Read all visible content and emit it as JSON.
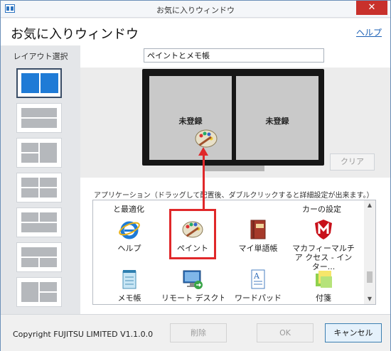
{
  "window": {
    "title": "お気に入りウィンドウ",
    "close_glyph": "✕"
  },
  "header": {
    "app_title": "お気に入りウィンドウ",
    "help_link": "ヘルプ"
  },
  "layout_panel": {
    "title": "レイアウト選択",
    "selected_index": 0
  },
  "preview": {
    "layout_name": "ペイントとメモ帳",
    "slots": [
      {
        "label": "未登録"
      },
      {
        "label": "未登録"
      }
    ],
    "clear_button": "クリア"
  },
  "apps": {
    "caption": "アプリケーション（ドラッグして配置後、ダブルクリックすると詳細設定が出来ます。）",
    "partial_top_labels": [
      "と最適化",
      "カーの設定"
    ],
    "items": [
      {
        "label": "ヘルプ",
        "icon": "ie-icon"
      },
      {
        "label": "ペイント",
        "icon": "paint-icon",
        "highlighted": true
      },
      {
        "label": "マイ単語帳",
        "icon": "dictionary-book-icon"
      },
      {
        "label": "マカフィーマルチア クセス - インター...",
        "icon": "mcafee-icon"
      },
      {
        "label": "メモ帳",
        "icon": "notepad-icon"
      },
      {
        "label": "リモート デスクトッ",
        "icon": "remote-desktop-icon"
      },
      {
        "label": "ワードパッド",
        "icon": "wordpad-icon"
      },
      {
        "label": "付箋",
        "icon": "sticky-notes-icon"
      }
    ]
  },
  "footer": {
    "copyright": "Copyright FUJITSU LIMITED V1.1.0.0",
    "delete_button": "削除",
    "ok_button": "OK",
    "cancel_button": "キャンセル"
  },
  "colors": {
    "accent": "#1f7bd6",
    "highlight": "#e0282a",
    "close": "#c8312c"
  }
}
